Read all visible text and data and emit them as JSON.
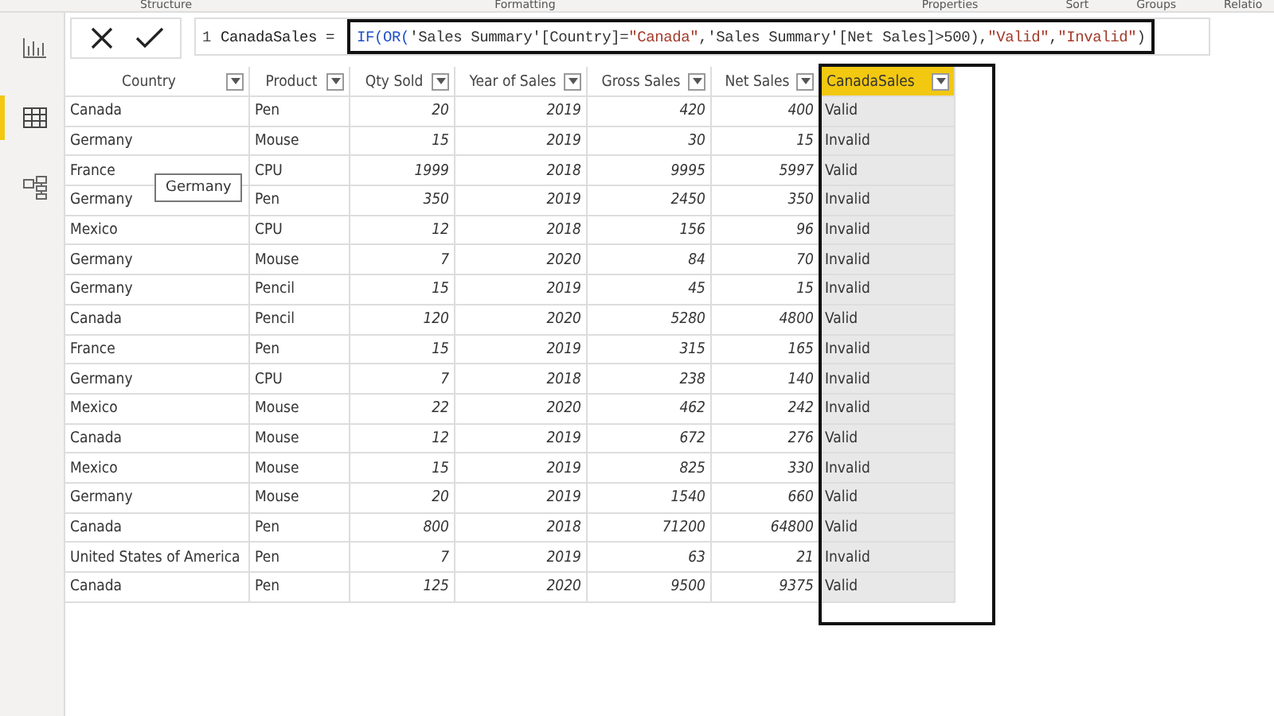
{
  "ribbon_groups": [
    "Structure",
    "Formatting",
    "Properties",
    "Sort",
    "Groups",
    "Relatio"
  ],
  "sidebar": [
    {
      "kind": "report",
      "selected": false
    },
    {
      "kind": "data",
      "selected": true
    },
    {
      "kind": "model",
      "selected": false
    }
  ],
  "formula_bar": {
    "line_number": "1",
    "prefix": "CanadaSales =",
    "highlighted": true,
    "tokens": [
      {
        "kind": "keyword",
        "text": "IF("
      },
      {
        "kind": "keyword",
        "text": "OR("
      },
      {
        "kind": "plain",
        "text": "'Sales Summary'[Country]="
      },
      {
        "kind": "string",
        "text": "\"Canada\""
      },
      {
        "kind": "plain",
        "text": ",'Sales Summary'[Net Sales]>500),"
      },
      {
        "kind": "string",
        "text": "\"Valid\""
      },
      {
        "kind": "plain",
        "text": ","
      },
      {
        "kind": "string",
        "text": "\"Invalid\""
      },
      {
        "kind": "plain",
        "text": ")"
      }
    ]
  },
  "table": {
    "columns": [
      {
        "name": "Country",
        "kind": "text",
        "selected": false
      },
      {
        "name": "Product",
        "kind": "text",
        "selected": false
      },
      {
        "name": "Qty Sold",
        "kind": "number",
        "selected": false
      },
      {
        "name": "Year of Sales",
        "kind": "number",
        "selected": false
      },
      {
        "name": "Gross Sales",
        "kind": "number",
        "selected": false
      },
      {
        "name": "Net Sales",
        "kind": "number",
        "selected": false
      },
      {
        "name": "CanadaSales",
        "kind": "text",
        "selected": true
      }
    ],
    "rows": [
      [
        "Canada",
        "Pen",
        "20",
        "2019",
        "420",
        "400",
        "Valid"
      ],
      [
        "Germany",
        "Mouse",
        "15",
        "2019",
        "30",
        "15",
        "Invalid"
      ],
      [
        "France",
        "CPU",
        "1999",
        "2018",
        "9995",
        "5997",
        "Valid"
      ],
      [
        "Germany",
        "Pen",
        "350",
        "2019",
        "2450",
        "350",
        "Invalid"
      ],
      [
        "Mexico",
        "CPU",
        "12",
        "2018",
        "156",
        "96",
        "Invalid"
      ],
      [
        "Germany",
        "Mouse",
        "7",
        "2020",
        "84",
        "70",
        "Invalid"
      ],
      [
        "Germany",
        "Pencil",
        "15",
        "2019",
        "45",
        "15",
        "Invalid"
      ],
      [
        "Canada",
        "Pencil",
        "120",
        "2020",
        "5280",
        "4800",
        "Valid"
      ],
      [
        "France",
        "Pen",
        "15",
        "2019",
        "315",
        "165",
        "Invalid"
      ],
      [
        "Germany",
        "CPU",
        "7",
        "2018",
        "238",
        "140",
        "Invalid"
      ],
      [
        "Mexico",
        "Mouse",
        "22",
        "2020",
        "462",
        "242",
        "Invalid"
      ],
      [
        "Canada",
        "Mouse",
        "12",
        "2019",
        "672",
        "276",
        "Valid"
      ],
      [
        "Mexico",
        "Mouse",
        "15",
        "2019",
        "825",
        "330",
        "Invalid"
      ],
      [
        "Germany",
        "Mouse",
        "20",
        "2019",
        "1540",
        "660",
        "Valid"
      ],
      [
        "Canada",
        "Pen",
        "800",
        "2018",
        "71200",
        "64800",
        "Valid"
      ],
      [
        "United States of America",
        "Pen",
        "7",
        "2019",
        "63",
        "21",
        "Invalid"
      ],
      [
        "Canada",
        "Pen",
        "125",
        "2020",
        "9500",
        "9375",
        "Valid"
      ]
    ],
    "highlight_selected_column": true
  },
  "tooltip": {
    "text": "Germany"
  }
}
